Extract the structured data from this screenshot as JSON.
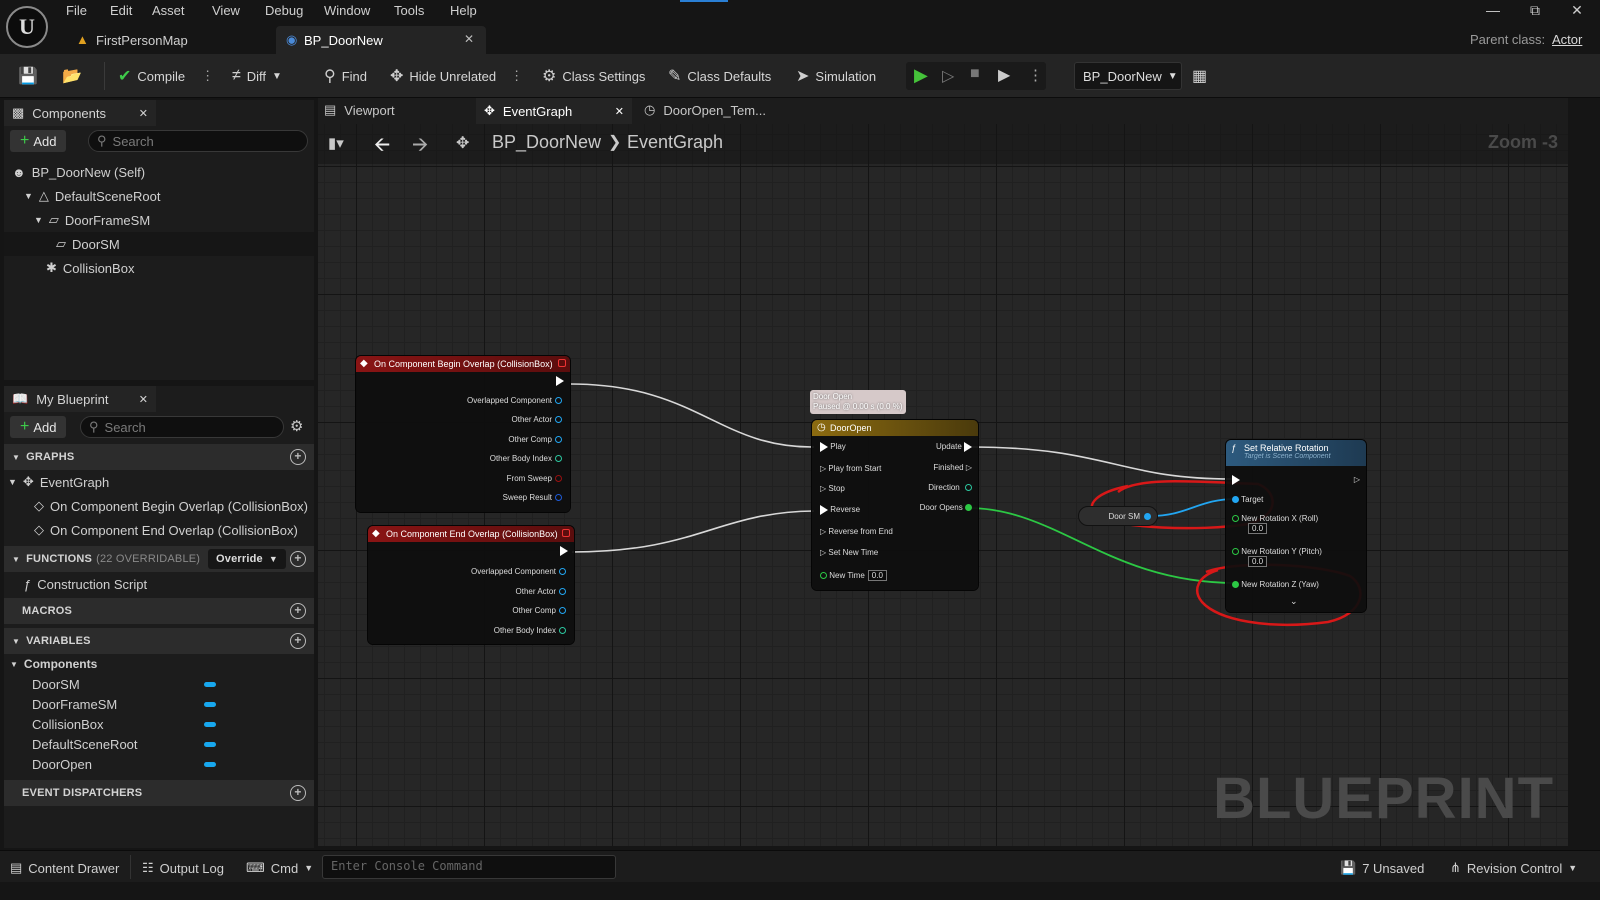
{
  "menu": {
    "items": [
      "File",
      "Edit",
      "Asset",
      "View",
      "Debug",
      "Window",
      "Tools",
      "Help"
    ],
    "logo": "U"
  },
  "tabs": {
    "map": "FirstPersonMap",
    "bp": "BP_DoorNew",
    "parent_label": "Parent class:",
    "parent_value": "Actor"
  },
  "toolbar": {
    "compile": "Compile",
    "diff": "Diff",
    "find": "Find",
    "hide_unrelated": "Hide Unrelated",
    "class_settings": "Class Settings",
    "class_defaults": "Class Defaults",
    "simulation": "Simulation",
    "debug_object": "BP_DoorNew"
  },
  "components": {
    "title": "Components",
    "add": "Add",
    "search_placeholder": "Search",
    "tree": [
      "BP_DoorNew (Self)",
      "DefaultSceneRoot",
      "DoorFrameSM",
      "DoorSM",
      "CollisionBox"
    ]
  },
  "my_blueprint": {
    "title": "My Blueprint",
    "add": "Add",
    "search_placeholder": "Search",
    "graphs_label": "GRAPHS",
    "event_graph": "EventGraph",
    "events": [
      "On Component Begin Overlap (CollisionBox)",
      "On Component End Overlap (CollisionBox)"
    ],
    "functions_label": "FUNCTIONS",
    "functions_count": "(22 OVERRIDABLE)",
    "override": "Override",
    "construction_script": "Construction Script",
    "macros_label": "MACROS",
    "variables_label": "VARIABLES",
    "components_cat": "Components",
    "variables": [
      "DoorSM",
      "DoorFrameSM",
      "CollisionBox",
      "DefaultSceneRoot",
      "DoorOpen"
    ],
    "dispatchers_label": "EVENT DISPATCHERS"
  },
  "graph_tabs": {
    "viewport": "Viewport",
    "event_graph": "EventGraph",
    "timeline": "DoorOpen_Tem..."
  },
  "breadcrumb": {
    "root": "BP_DoorNew",
    "graph": "EventGraph",
    "zoom": "Zoom -3"
  },
  "nodes": {
    "begin_overlap": {
      "title": "On Component Begin Overlap (CollisionBox)",
      "pins": [
        "Overlapped Component",
        "Other Actor",
        "Other Comp",
        "Other Body Index",
        "From Sweep",
        "Sweep Result"
      ]
    },
    "end_overlap": {
      "title": "On Component End Overlap (CollisionBox)",
      "pins": [
        "Overlapped Component",
        "Other Actor",
        "Other Comp",
        "Other Body Index"
      ]
    },
    "timeline_comment": {
      "line1": "Door Open",
      "line2": "Paused @ 0.00 s (0.0 %)"
    },
    "timeline": {
      "title": "DoorOpen",
      "inputs": [
        "Play",
        "Play from Start",
        "Stop",
        "Reverse",
        "Reverse from End",
        "Set New Time",
        "New Time"
      ],
      "outputs": [
        "Update",
        "Finished",
        "Direction",
        "Door Opens"
      ],
      "new_time_value": "0.0"
    },
    "door_sm": {
      "label": "Door SM"
    },
    "set_rotation": {
      "title": "Set Relative Rotation",
      "subtitle": "Target is Scene Component",
      "pins": [
        "Target",
        "New Rotation X (Roll)",
        "New Rotation Y (Pitch)",
        "New Rotation Z (Yaw)"
      ],
      "x_value": "0.0",
      "y_value": "0.0"
    }
  },
  "watermark": "BLUEPRINT",
  "status": {
    "content_drawer": "Content Drawer",
    "output_log": "Output Log",
    "cmd": "Cmd",
    "console_placeholder": "Enter Console Command",
    "unsaved": "7 Unsaved",
    "revision": "Revision Control"
  },
  "colors": {
    "event_header": "#8a1414",
    "timeline_header": "#8c6b10",
    "function_header": "#2d5a7e",
    "annotation": "#d81818",
    "object_pin": "#22a6f2",
    "float_pin": "#2cc844"
  }
}
